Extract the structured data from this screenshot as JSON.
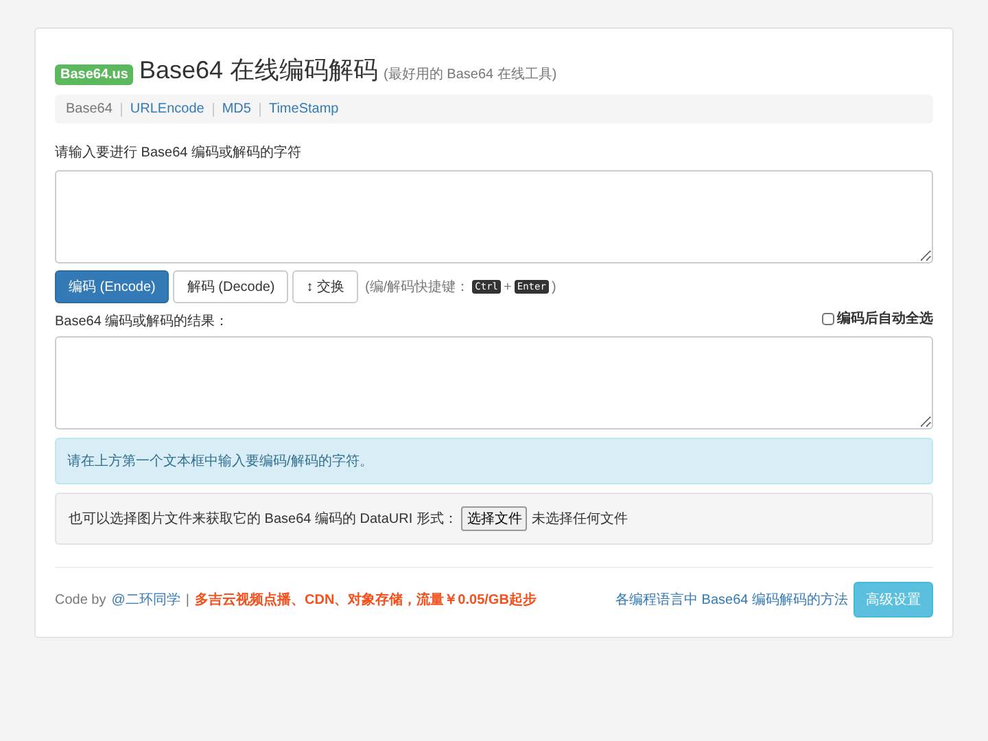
{
  "header": {
    "badge": "Base64.us",
    "title": "Base64 在线编码解码",
    "subtitle": "(最好用的 Base64 在线工具)"
  },
  "nav": [
    {
      "label": "Base64",
      "selected": true
    },
    {
      "label": "URLEncode",
      "selected": false
    },
    {
      "label": "MD5",
      "selected": false
    },
    {
      "label": "TimeStamp",
      "selected": false
    }
  ],
  "input_label": "请输入要进行 Base64 编码或解码的字符",
  "buttons": [
    {
      "label": "编码 (Encode)",
      "kind": "primary"
    },
    {
      "label": "解码 (Decode)",
      "kind": "default"
    },
    {
      "label": "↕ 交换",
      "kind": "default"
    }
  ],
  "shortcut": {
    "prefix": "(编/解码快捷键：",
    "key1": "Ctrl",
    "plus": "+",
    "key2": "Enter",
    "suffix": ")"
  },
  "result_label": "Base64 编码或解码的结果：",
  "auto_select": {
    "label": "编码后自动全选",
    "checked": false
  },
  "alert": "请在上方第一个文本框中输入要编码/解码的字符。",
  "file_panel": {
    "text": "也可以选择图片文件来获取它的 Base64 编码的 DataURI 形式：",
    "button": "选择文件",
    "status": "未选择任何文件"
  },
  "footer": {
    "code_by": "Code by",
    "author": "@二环同学",
    "separator": "|",
    "promo": "多吉云视频点播、CDN、对象存储，流量￥0.05/GB起步",
    "methods_link": "各编程语言中 Base64 编码解码的方法",
    "settings_button": "高级设置"
  }
}
